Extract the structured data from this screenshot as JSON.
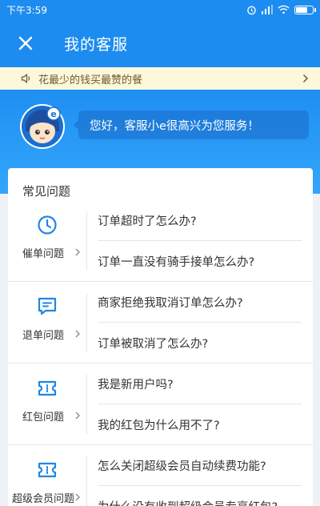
{
  "status_bar": {
    "time": "下午3:59"
  },
  "header": {
    "title": "我的客服",
    "close_icon": "close-icon"
  },
  "notice": {
    "text": "花最少的钱买最赞的餐"
  },
  "hero": {
    "greeting": "您好，客服小e很高兴为您服务！"
  },
  "faq": {
    "heading": "常见问题",
    "groups": [
      {
        "label": "催单问题",
        "icon": "clock-icon",
        "questions": [
          "订单超时了怎么办?",
          "订单一直没有骑手接单怎么办?"
        ]
      },
      {
        "label": "退单问题",
        "icon": "chat-icon",
        "questions": [
          "商家拒绝我取消订单怎么办?",
          "订单被取消了怎么办?"
        ]
      },
      {
        "label": "红包问题",
        "icon": "ticket-icon",
        "questions": [
          "我是新用户吗?",
          "我的红包为什么用不了?"
        ]
      },
      {
        "label": "超级会员问题",
        "icon": "ticket-icon",
        "questions": [
          "怎么关闭超级会员自动续费功能?",
          "为什么没有收到超级会员专享红包?"
        ]
      }
    ]
  },
  "colors": {
    "primary": "#1d8cf0",
    "notice_bg": "#fdf7db",
    "icon_blue": "#1f86e6"
  }
}
